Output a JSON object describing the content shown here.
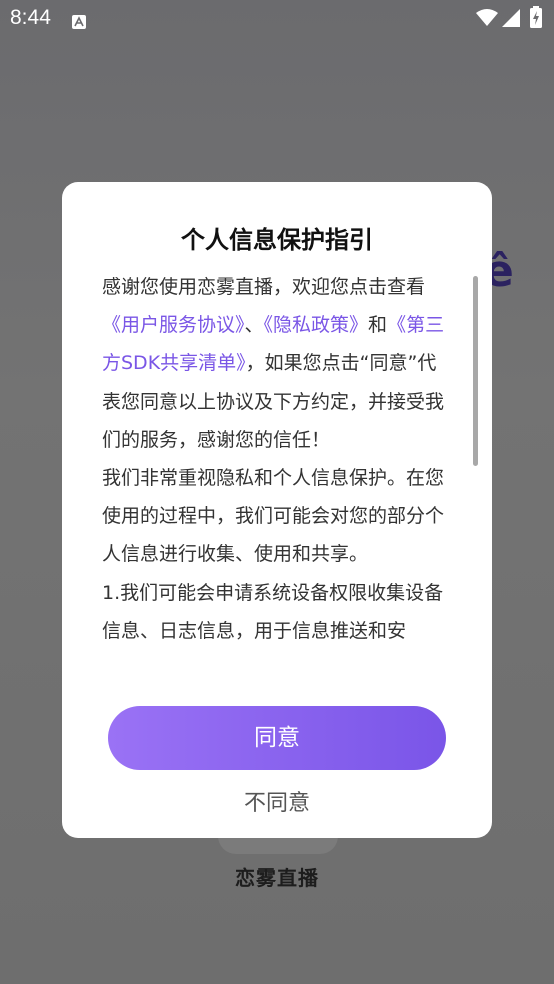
{
  "status_bar": {
    "time": "8:44"
  },
  "background": {
    "partial_char": "ê",
    "app_name": "恋雾直播"
  },
  "dialog": {
    "title": "个人信息保护指引",
    "para1": {
      "t1": "感谢您使用恋雾直播，欢迎您点击查看",
      "link1": "《用户服务协议》",
      "t2": "、",
      "link2": "《隐私政策》",
      "t3": "和",
      "link3": "《第三方SDK共享清单》",
      "t4": "，如果您点击“同意”代表您同意以上协议及下方约定，并接受我们的服务，感谢您的信任！"
    },
    "para2": "我们非常重视隐私和个人信息保护。在您使用的过程中，我们可能会对您的部分个人信息进行收集、使用和共享。",
    "para3": "1.我们可能会申请系统设备权限收集设备信息、日志信息，用于信息推送和安",
    "agree_label": "同意",
    "disagree_label": "不同意"
  },
  "colors": {
    "accent": "#7a56e6",
    "button_gradient_start": "#9a72f5",
    "button_gradient_end": "#7a55e8"
  }
}
